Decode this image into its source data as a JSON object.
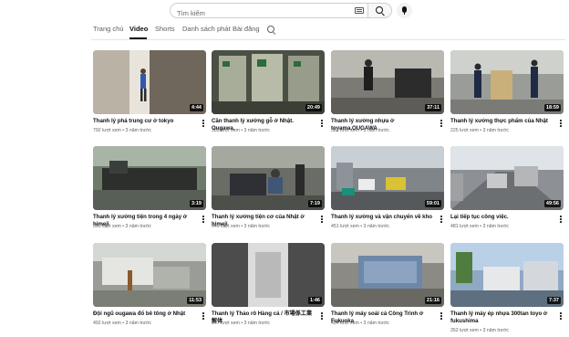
{
  "search": {
    "placeholder": "Tìm kiếm"
  },
  "tabs": [
    {
      "label": "Trang chủ",
      "active": false
    },
    {
      "label": "Video",
      "active": true
    },
    {
      "label": "Shorts",
      "active": false
    },
    {
      "label": "Danh sách phát",
      "active": false
    },
    {
      "label": "Bài đăng",
      "active": false
    }
  ],
  "icons": {
    "search": "search-icon",
    "keyboard": "keyboard-icon",
    "mic": "microphone-icon",
    "menu": "more-vert-icon"
  },
  "videos": [
    {
      "title": "Thanh lý phá trung cư ở tokyo",
      "views": "792 lượt xem",
      "ago": "3 năm trước",
      "duration": "4:44"
    },
    {
      "title": "Cần thanh lý xưởng gỗ ở Nhật. Ougawa.",
      "views": "383 lượt xem",
      "ago": "3 năm trước",
      "duration": "20:49"
    },
    {
      "title": "Thanh lý xưởng nhựa ở toyama.OUGAWA",
      "views": "581 lượt xem",
      "ago": "3 năm trước",
      "duration": "37:11"
    },
    {
      "title": "Thanh lý xưởng thực phẩm của Nhật",
      "views": "225 lượt xem",
      "ago": "3 năm trước",
      "duration": "18:59"
    },
    {
      "title": "Thanh lý xưởng tiện trong 4 ngày ở himeji",
      "views": "590 lượt xem",
      "ago": "3 năm trước",
      "duration": "3:19"
    },
    {
      "title": "Thanh lý xưởng tiện cơ của Nhật ở himeji",
      "views": "649 lượt xem",
      "ago": "3 năm trước",
      "duration": "7:19"
    },
    {
      "title": "Thanh lý xưởng và vận chuyển về kho",
      "views": "451 lượt xem",
      "ago": "3 năm trước",
      "duration": "59:01"
    },
    {
      "title": "Lại tiếp tục công việc.",
      "views": "481 lượt xem",
      "ago": "3 năm trước",
      "duration": "49:56"
    },
    {
      "title": "Đội ngũ ougawa đổ bê tông ở Nhật",
      "views": "492 lượt xem",
      "ago": "3 năm trước",
      "duration": "11:53"
    },
    {
      "title": "Thanh lý Thảo rô Hàng cá / 市場係工業解体",
      "views": "147 lượt xem",
      "ago": "3 năm trước",
      "duration": "1:46"
    },
    {
      "title": "Thanh lý máy soái cá Công Trình ở Fukuoka",
      "views": "454 lượt xem",
      "ago": "3 năm trước",
      "duration": "21:16"
    },
    {
      "title": "Thanh lý máy ép nhựa 300tan toyo ở fukushima",
      "views": "352 lượt xem",
      "ago": "3 năm trước",
      "duration": "7:37"
    }
  ]
}
